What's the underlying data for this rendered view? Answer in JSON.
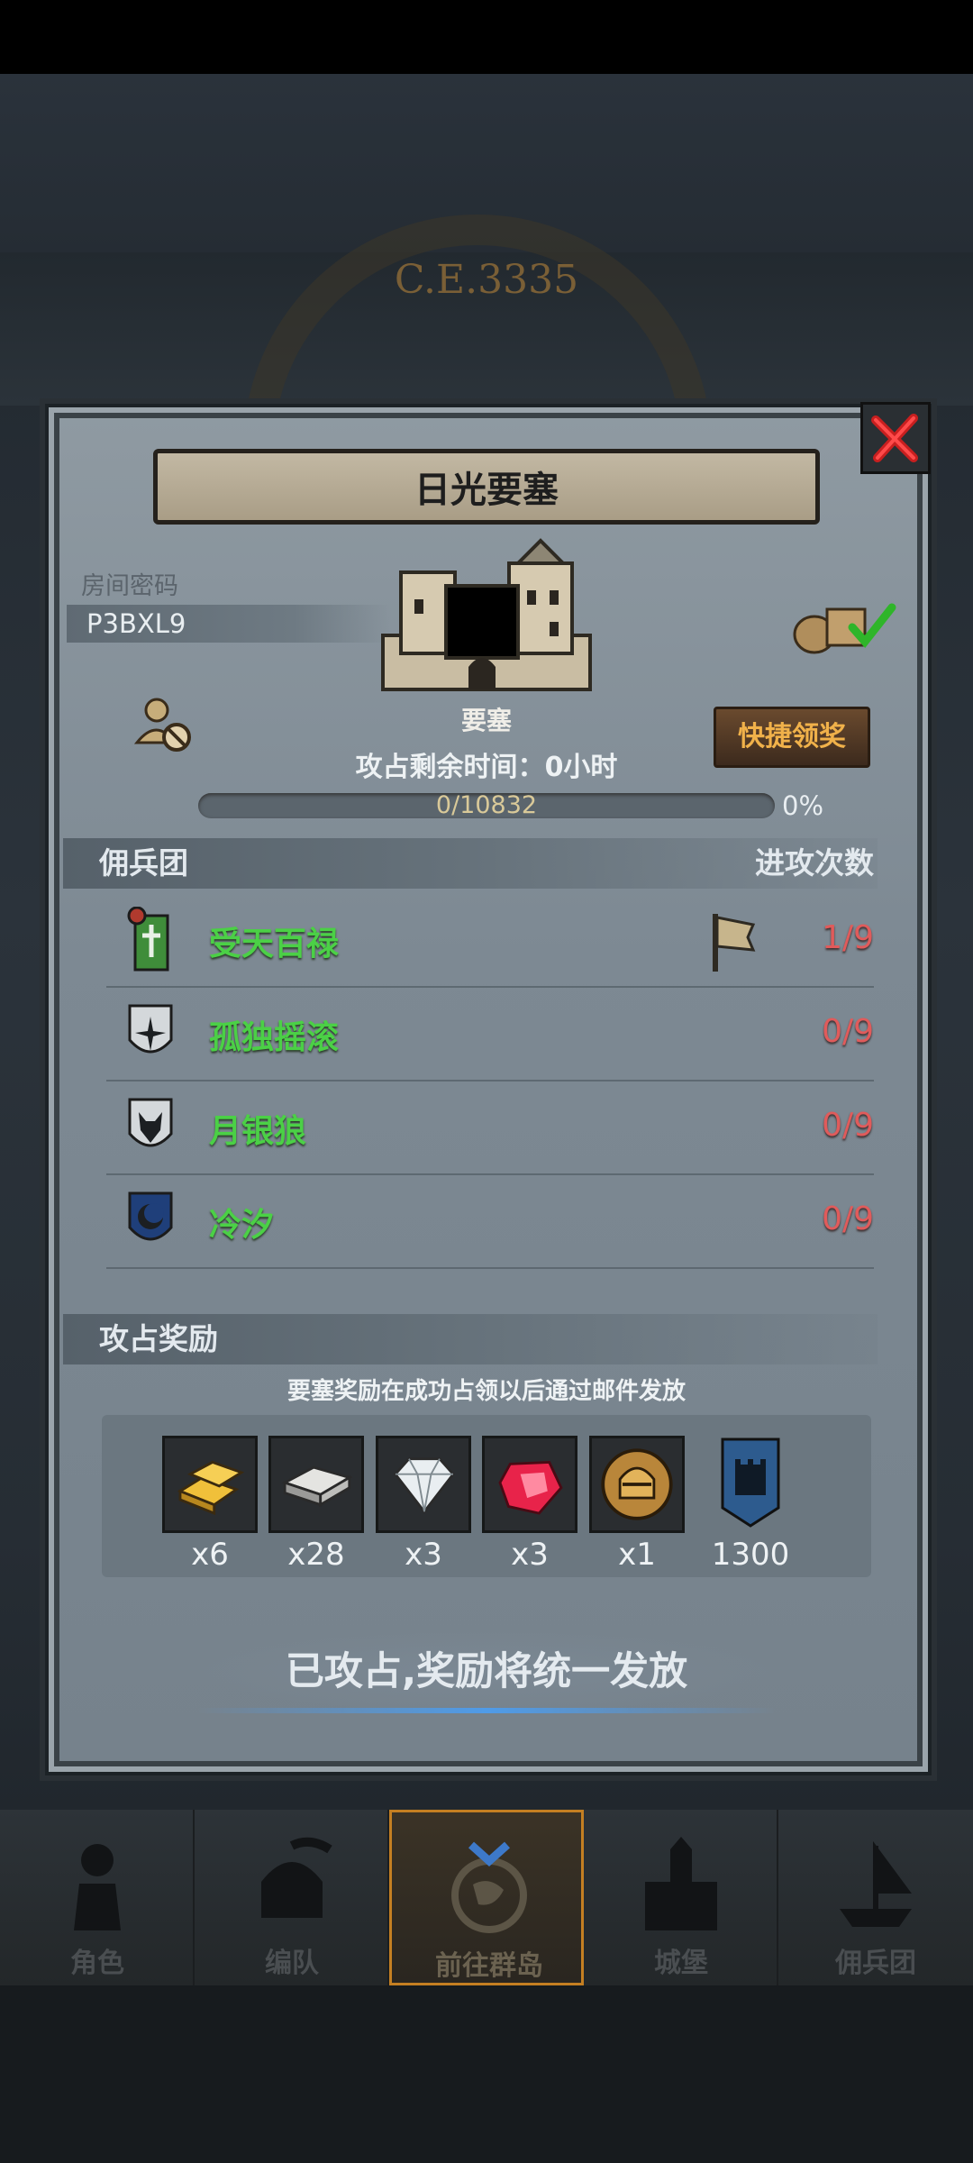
{
  "background": {
    "era_text": "C.E.3335"
  },
  "dialog": {
    "title": "日光要塞",
    "room_label": "房间密码",
    "room_code": "P3BXL9",
    "fort_label": "要塞",
    "timer_label": "攻占剩余时间：",
    "timer_value": "0小时",
    "progress_text": "0/10832",
    "progress_value": 0,
    "progress_pct": "0%",
    "claim_button": "快捷领奖",
    "mercenary_header": "佣兵团",
    "attack_count_header": "进攻次数",
    "guilds": [
      {
        "name": "受天百禄",
        "count": "1/9",
        "emblem": "green-banner-icon"
      },
      {
        "name": "孤独摇滚",
        "count": "0/9",
        "emblem": "star-shield-icon"
      },
      {
        "name": "月银狼",
        "count": "0/9",
        "emblem": "wolf-shield-icon"
      },
      {
        "name": "冷汐",
        "count": "0/9",
        "emblem": "crescent-shield-icon"
      }
    ],
    "reward_header": "攻占奖励",
    "reward_note": "要塞奖励在成功占领以后通过邮件发放",
    "rewards": [
      {
        "icon": "gold-bar-icon",
        "qty": "x6"
      },
      {
        "icon": "iron-bar-icon",
        "qty": "x28"
      },
      {
        "icon": "diamond-icon",
        "qty": "x3"
      },
      {
        "icon": "ruby-icon",
        "qty": "x3"
      },
      {
        "icon": "helmet-coin-icon",
        "qty": "x1"
      },
      {
        "icon": "castle-banner-icon",
        "qty": "1300"
      }
    ],
    "status_text": "已攻占,奖励将统一发放"
  },
  "bottom_nav": [
    {
      "label": "角色",
      "icon": "knight-icon"
    },
    {
      "label": "编队",
      "icon": "helmet-icon"
    },
    {
      "label": "前往群岛",
      "icon": "globe-icon",
      "active": true
    },
    {
      "label": "城堡",
      "icon": "castle-icon"
    },
    {
      "label": "佣兵团",
      "icon": "ship-icon"
    }
  ],
  "colors": {
    "guild_name": "#4bd046",
    "attack_count": "#e05b5b",
    "claim_text": "#f0b14a",
    "active_tab_border": "#c47f22"
  }
}
